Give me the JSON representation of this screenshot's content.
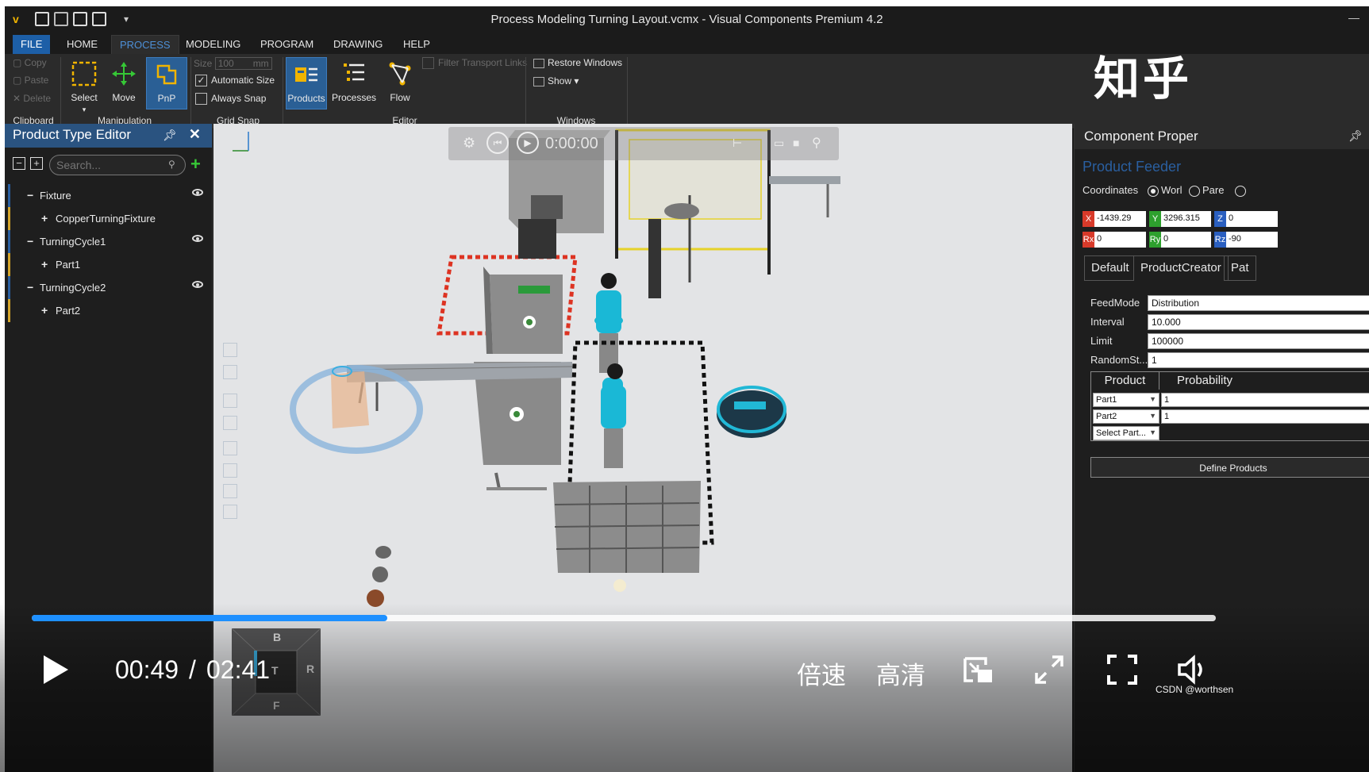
{
  "window": {
    "title": "Process Modeling Turning Layout.vcmx - Visual Components Premium 4.2"
  },
  "menu_tabs": [
    "FILE",
    "HOME",
    "PROCESS",
    "MODELING",
    "PROGRAM",
    "DRAWING",
    "HELP"
  ],
  "ribbon": {
    "clipboard": {
      "copy": "Copy",
      "paste": "Paste",
      "delete": "Delete",
      "label": "Clipboard"
    },
    "manipulation": {
      "select": "Select",
      "move": "Move",
      "pnp": "PnP",
      "label": "Manipulation"
    },
    "grid_snap": {
      "size_label": "Size",
      "size_value": "100",
      "size_unit": "mm",
      "automatic_size": "Automatic Size",
      "always_snap": "Always Snap",
      "label": "Grid Snap"
    },
    "editor": {
      "products": "Products",
      "processes": "Processes",
      "flow": "Flow",
      "filter_transport_links": "Filter Transport Links",
      "label": "Editor"
    },
    "windows": {
      "restore_windows": "Restore Windows",
      "show": "Show ▾",
      "label": "Windows"
    }
  },
  "watermark": "知乎",
  "left_panel": {
    "title": "Product Type Editor",
    "search_placeholder": "Search...",
    "tree": [
      {
        "sign": "−",
        "label": "Fixture",
        "level": 0,
        "eye": true
      },
      {
        "sign": "+",
        "label": "CopperTurningFixture",
        "level": 1,
        "eye": false
      },
      {
        "sign": "−",
        "label": "TurningCycle1",
        "level": 0,
        "eye": true
      },
      {
        "sign": "+",
        "label": "Part1",
        "level": 1,
        "eye": false
      },
      {
        "sign": "−",
        "label": "TurningCycle2",
        "level": 0,
        "eye": true
      },
      {
        "sign": "+",
        "label": "Part2",
        "level": 1,
        "eye": false
      }
    ]
  },
  "viewport": {
    "sim_time": "0:00:00"
  },
  "right_panel": {
    "title": "Component Proper",
    "component_name": "Product Feeder",
    "coordinates_label": "Coordinates",
    "coord_options": [
      "Worl",
      "Pare"
    ],
    "coords": {
      "x": "-1439.29",
      "y": "3296.315",
      "z": "0",
      "rx": "0",
      "ry": "0",
      "rz": "-90"
    },
    "tabs": [
      "Default",
      "ProductCreator",
      "Pat"
    ],
    "properties": [
      {
        "label": "FeedMode",
        "value": "Distribution"
      },
      {
        "label": "Interval",
        "value": "10.000"
      },
      {
        "label": "Limit",
        "value": "100000"
      },
      {
        "label": "RandomSt...",
        "value": "1"
      }
    ],
    "table": {
      "headers": [
        "Product",
        "Probability"
      ],
      "rows": [
        {
          "product": "Part1",
          "probability": "1"
        },
        {
          "product": "Part2",
          "probability": "1"
        },
        {
          "product": "Select Part...",
          "probability": ""
        }
      ]
    },
    "define_button": "Define Products"
  },
  "player": {
    "current_time": "00:49",
    "separator": "/",
    "total_time": "02:41",
    "progress": 0.3,
    "speed": "倍速",
    "quality": "高清"
  },
  "nav_cube": {
    "top": "B",
    "right": "R",
    "center": "T",
    "bottom": "F"
  },
  "credit": "CSDN @worthsen",
  "colors": {
    "accent": "#1e90ff",
    "panel_header": "#2a5380",
    "component_name": "#2a5fa0"
  }
}
